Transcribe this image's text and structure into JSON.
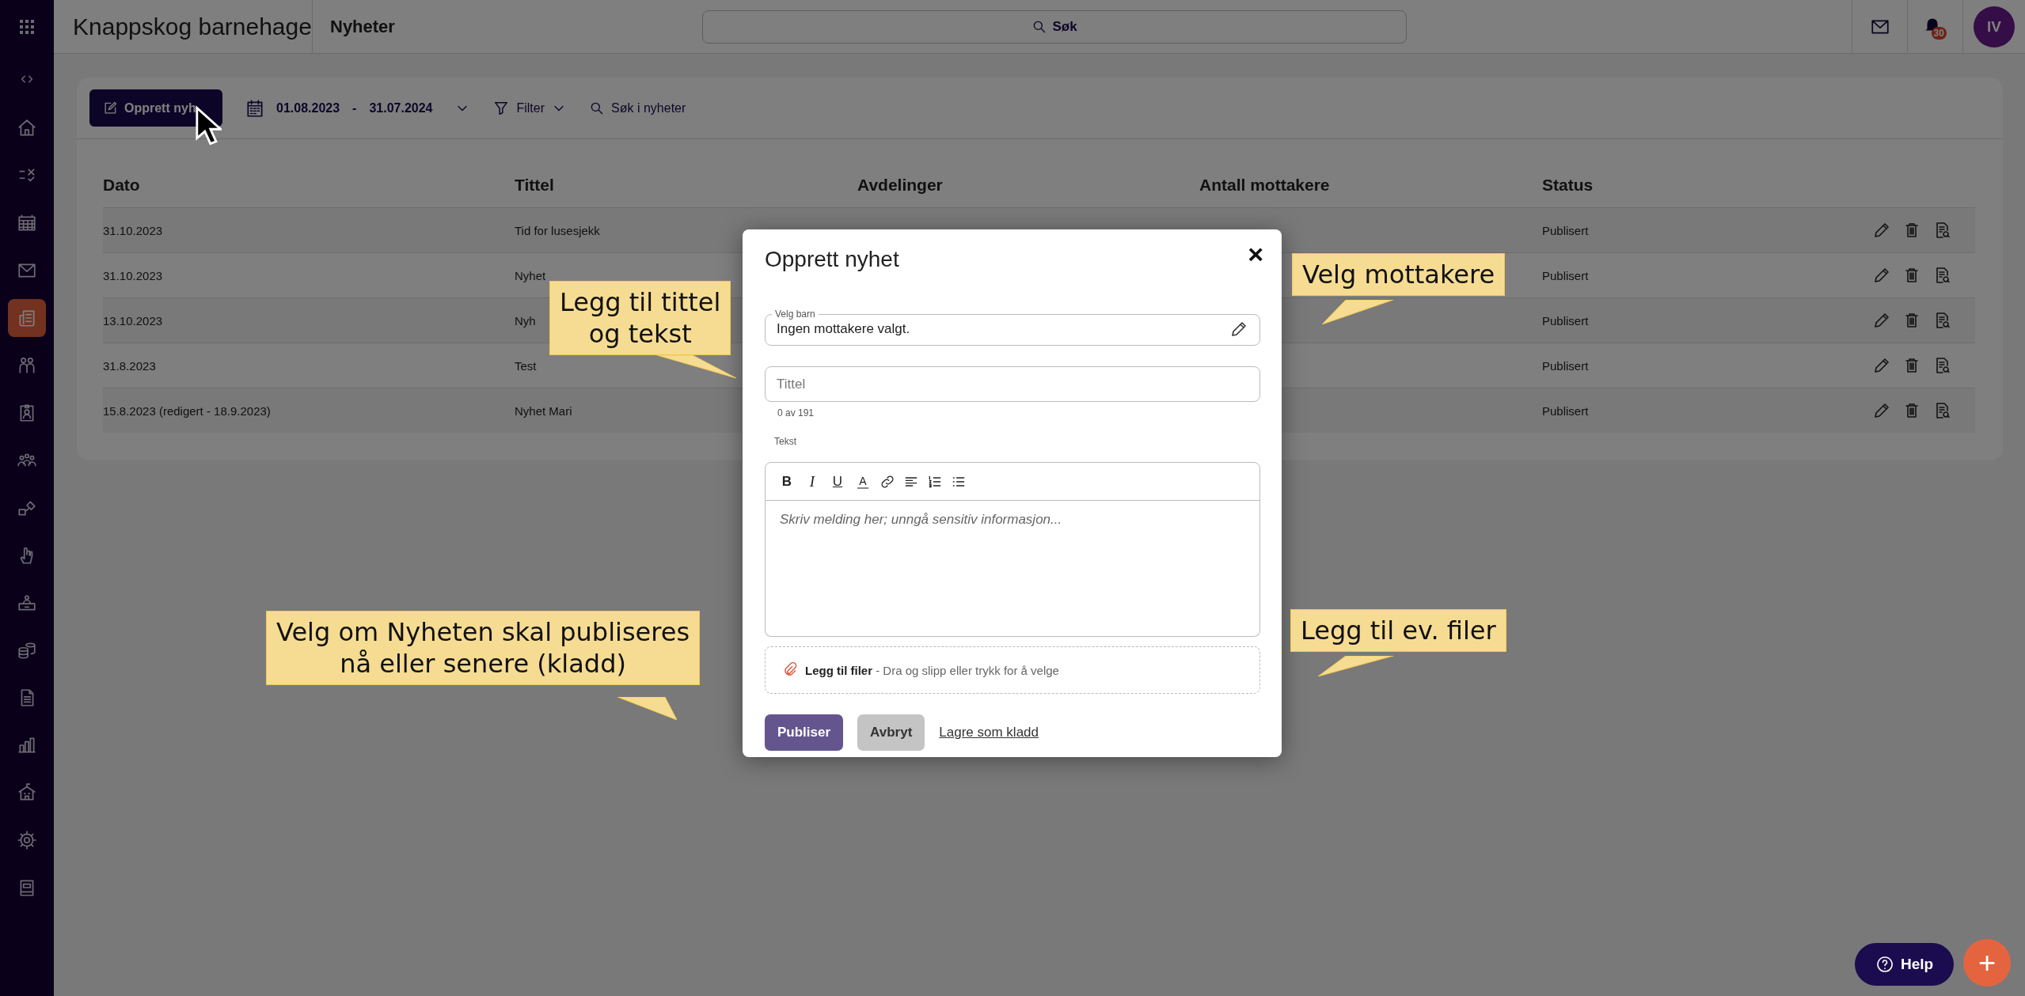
{
  "sidebar": {
    "items": [
      {
        "selected": false
      },
      {
        "selected": false
      },
      {
        "selected": false
      },
      {
        "selected": false
      },
      {
        "selected": true
      },
      {
        "selected": false
      },
      {
        "selected": false
      },
      {
        "selected": false
      },
      {
        "selected": false
      },
      {
        "selected": false
      },
      {
        "selected": false
      },
      {
        "selected": false
      },
      {
        "selected": false
      },
      {
        "selected": false
      },
      {
        "selected": false
      },
      {
        "selected": false
      },
      {
        "selected": false
      }
    ]
  },
  "topbar": {
    "org": "Knappskog barnehage",
    "page": "Nyheter",
    "search": {
      "label": "Søk"
    },
    "notifications": "30",
    "avatar": "IV"
  },
  "toolbar": {
    "create_button": "Opprett nyh",
    "date_from": "01.08.2023",
    "separator": "-",
    "date_to": "31.07.2024",
    "filter": "Filter",
    "search_link": "Søk i nyheter"
  },
  "table": {
    "columns": [
      "Dato",
      "Tittel",
      "Avdelinger",
      "Antall mottakere",
      "Status"
    ],
    "rows": [
      {
        "date": "31.10.2023",
        "title": "Tid for lusesjekk",
        "status": "Publisert"
      },
      {
        "date": "31.10.2023",
        "title": "Nyhet",
        "status": "Publisert"
      },
      {
        "date": "13.10.2023",
        "title": "Nyh",
        "status": "Publisert"
      },
      {
        "date": "31.8.2023",
        "title": "Test",
        "status": "Publisert"
      },
      {
        "date": "15.8.2023 (redigert - 18.9.2023)",
        "title": "Nyhet Mari",
        "status": "Publisert"
      }
    ]
  },
  "dialog": {
    "title": "Opprett nyhet",
    "close": "×",
    "recipients": {
      "label": "Velg barn",
      "value": "Ingen mottakere valgt."
    },
    "title_field": {
      "placeholder": "Tittel",
      "counter": "0 av 191"
    },
    "text_label": "Tekst",
    "editor": {
      "toolbar": [
        {
          "kind": "bold",
          "label": "B"
        },
        {
          "kind": "italic",
          "label": "I"
        },
        {
          "kind": "underline",
          "label": "U"
        },
        {
          "kind": "color",
          "label": "A"
        },
        {
          "kind": "link"
        },
        {
          "kind": "align"
        },
        {
          "kind": "ordered"
        },
        {
          "kind": "bullets"
        }
      ],
      "placeholder": "Skriv melding her; unngå sensitiv informasjon..."
    },
    "attachments": "**Legg til filer** - Dra og slipp eller trykk for å velge",
    "publish_button": "Publiser",
    "cancel_button": "Avbryt",
    "draft_link": "Lagre som kladd"
  },
  "annotations": [
    {
      "text": "Legg til tittel\nog tekst"
    },
    {
      "text": "Velg mottakere"
    },
    {
      "text": "Velg om Nyheten skal publiseres\nnå eller senere (kladd)"
    },
    {
      "text": "Legg til ev. filer"
    }
  ],
  "help_button": "Help",
  "add_button": "+"
}
